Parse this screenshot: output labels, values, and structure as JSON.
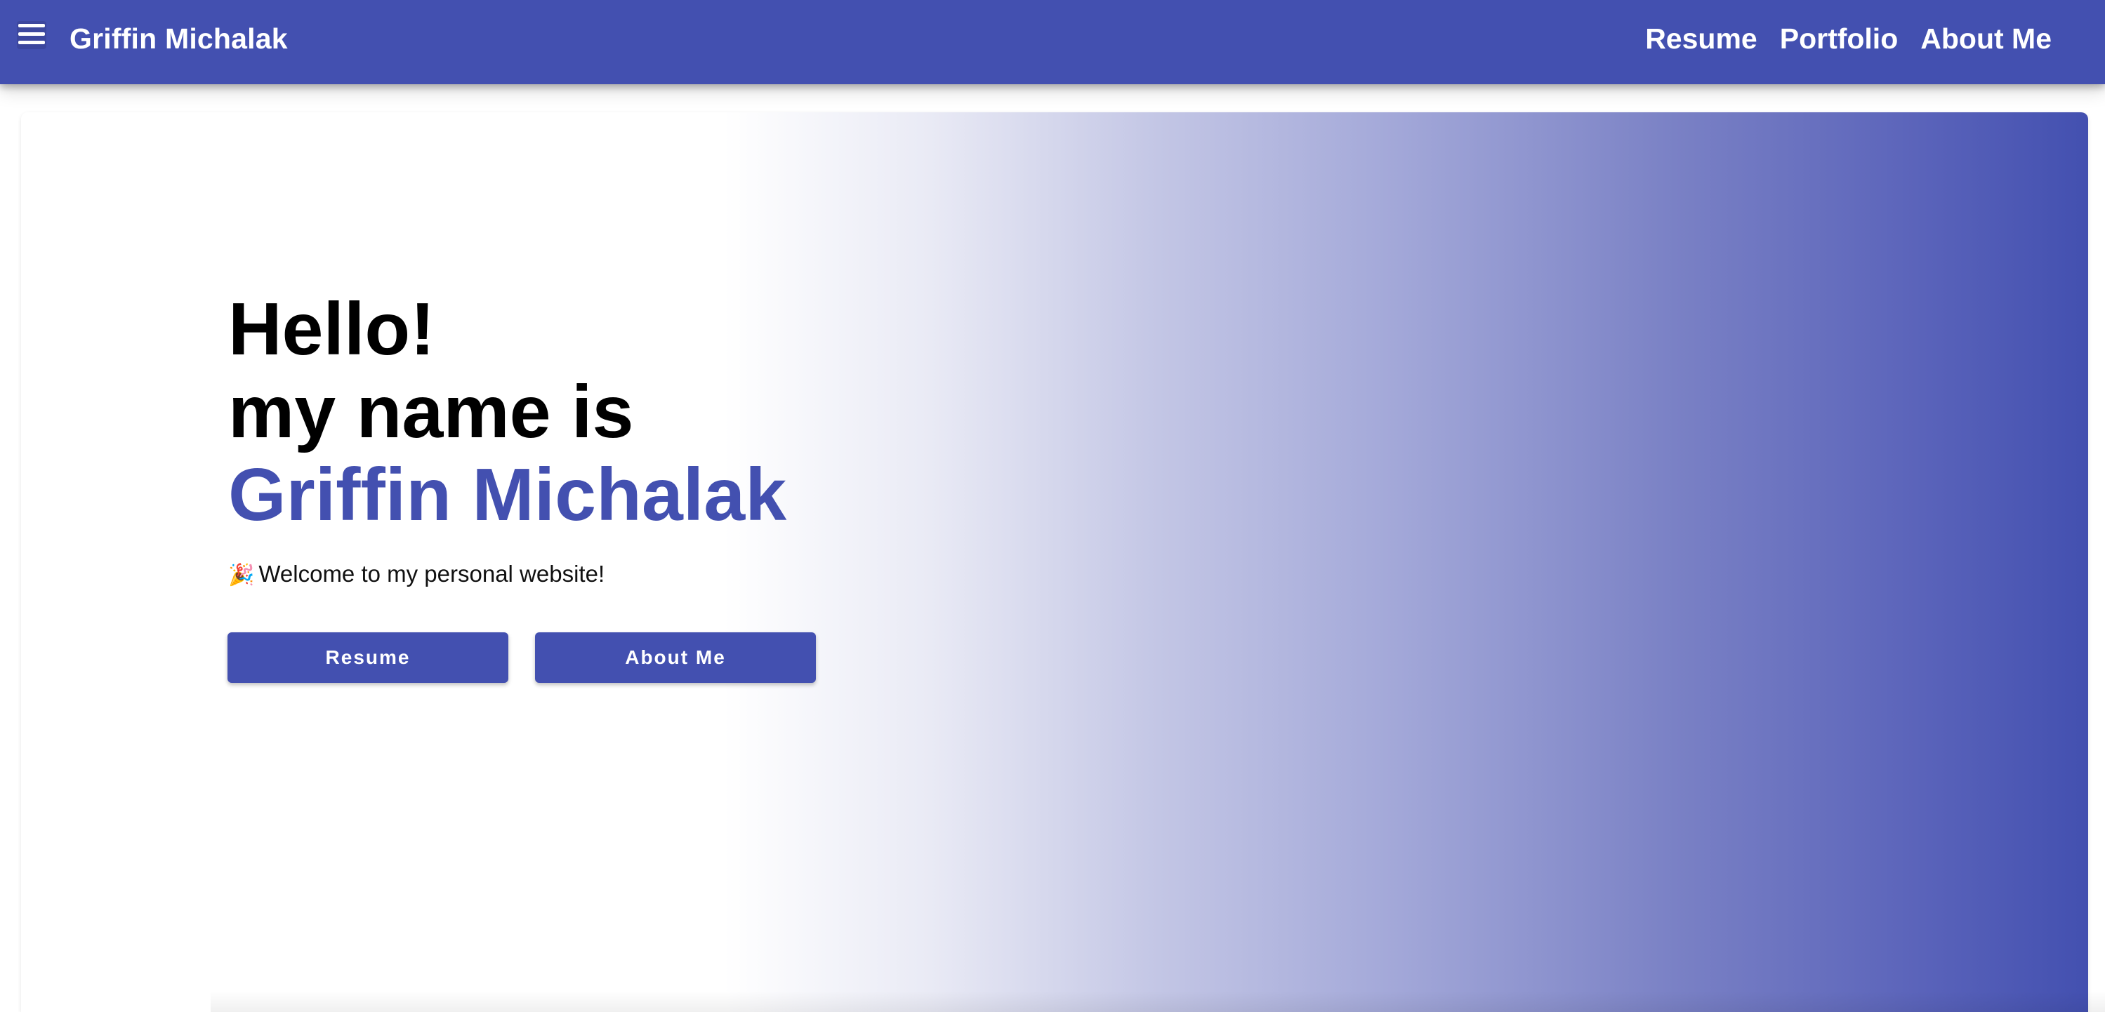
{
  "header": {
    "brand": "Griffin Michalak",
    "menu_icon": "hamburger-menu-icon",
    "nav": [
      {
        "label": "Resume"
      },
      {
        "label": "Portfolio"
      },
      {
        "label": "About Me"
      }
    ]
  },
  "hero": {
    "greeting": "Hello!",
    "intro": "my name is",
    "name": "Griffin Michalak",
    "welcome_emoji": "🎉",
    "welcome_text": "Welcome to my personal website!",
    "buttons": [
      {
        "label": "Resume"
      },
      {
        "label": "About Me"
      }
    ]
  },
  "colors": {
    "primary": "#4350b0",
    "background": "#ffffff",
    "text": "#000000"
  }
}
